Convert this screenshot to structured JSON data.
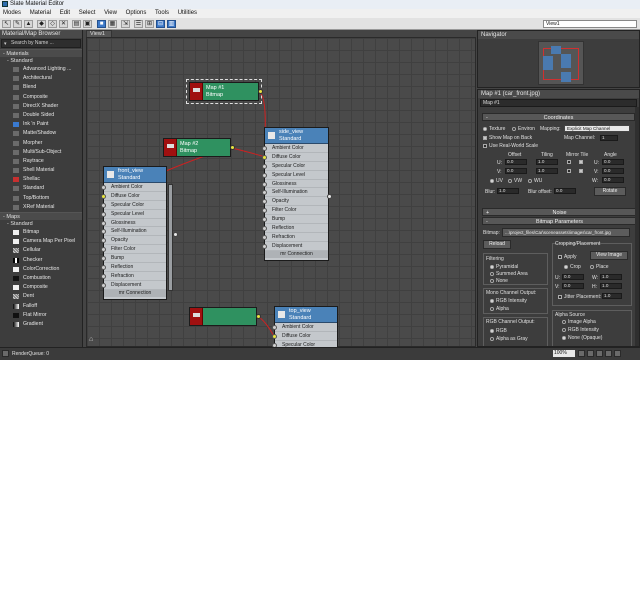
{
  "window": {
    "title": "Slate Material Editor"
  },
  "menu": [
    "Modes",
    "Material",
    "Edit",
    "Select",
    "View",
    "Options",
    "Tools",
    "Utilities"
  ],
  "toolbar": {
    "view_selector": "View1"
  },
  "browser": {
    "title": "Material/Map Browser",
    "search_placeholder": "Search by Name ...",
    "materials_label": "Materials",
    "standard_label": "Standard",
    "materials": [
      {
        "label": "Advanced Lighting ...",
        "swatch": "grey"
      },
      {
        "label": "Architectural",
        "swatch": "grey"
      },
      {
        "label": "Blend",
        "swatch": "grey"
      },
      {
        "label": "Composite",
        "swatch": "grey"
      },
      {
        "label": "DirectX Shader",
        "swatch": "grey"
      },
      {
        "label": "Double Sided",
        "swatch": "grey"
      },
      {
        "label": "Ink 'n Paint",
        "swatch": "blue"
      },
      {
        "label": "Matte/Shadow",
        "swatch": "grey"
      },
      {
        "label": "Morpher",
        "swatch": "grey"
      },
      {
        "label": "Multi/Sub-Object",
        "swatch": "grey"
      },
      {
        "label": "Raytrace",
        "swatch": "grey"
      },
      {
        "label": "Shell Material",
        "swatch": "grey"
      },
      {
        "label": "Shellac",
        "swatch": "red"
      },
      {
        "label": "Standard",
        "swatch": "grey"
      },
      {
        "label": "Top/Bottom",
        "swatch": "grey"
      },
      {
        "label": "XRef Material",
        "swatch": "grey"
      }
    ],
    "maps_label": "Maps",
    "maps_standard_label": "Standard",
    "maps": [
      {
        "label": "Bitmap",
        "swatch": "white"
      },
      {
        "label": "Camera Map Per Pixel",
        "swatch": "white"
      },
      {
        "label": "Cellular",
        "swatch": "noise"
      },
      {
        "label": "Checker",
        "swatch": "check"
      },
      {
        "label": "ColorCorrection",
        "swatch": "white"
      },
      {
        "label": "Combustion",
        "swatch": "black"
      },
      {
        "label": "Composite",
        "swatch": "white"
      },
      {
        "label": "Dent",
        "swatch": "noise"
      },
      {
        "label": "Falloff",
        "swatch": "grad"
      },
      {
        "label": "Flat Mirror",
        "swatch": "black"
      },
      {
        "label": "Gradient",
        "swatch": "grad"
      }
    ]
  },
  "view": {
    "tab_label": "View1"
  },
  "nodes": {
    "map1": {
      "name": "Map #1",
      "type": "Bitmap"
    },
    "map2": {
      "name": "Map #2",
      "type": "Bitmap"
    },
    "map3": {
      "name": "",
      "type": ""
    },
    "front_view": {
      "name": "front_view",
      "type": "Standard"
    },
    "side_view": {
      "name": "side_view",
      "type": "Standard"
    },
    "top_view": {
      "name": "top_view",
      "type": "Standard"
    },
    "slots": [
      "Ambient Color",
      "Diffuse Color",
      "Specular Color",
      "Specular Level",
      "Glossiness",
      "Self-Illumination",
      "Opacity",
      "Filter Color",
      "Bump",
      "Reflection",
      "Refraction",
      "Displacement"
    ],
    "top_slots": [
      "Ambient Color",
      "Diffuse Color",
      "Specular Color"
    ],
    "footer": "mr Connection"
  },
  "navigator": {
    "title": "Navigator"
  },
  "params": {
    "title": "Map #1 (car_front.jpg)",
    "name_value": "Map #1",
    "coordinates": {
      "title": "Coordinates",
      "texture": "Texture",
      "environ": "Environ",
      "mapping_label": "Mapping:",
      "mapping_value": "Explicit Map Channel",
      "show_map": "Show Map on Back",
      "real_world": "Use Real-World Scale",
      "map_channel_label": "Map Channel:",
      "map_channel_value": "1",
      "offset": "Offset",
      "tiling": "Tiling",
      "mirror_tile": "Mirror Tile",
      "angle": "Angle",
      "u": "U:",
      "v": "V:",
      "w": "W:",
      "u_offset": "0.0",
      "v_offset": "0.0",
      "u_tiling": "1.0",
      "v_tiling": "1.0",
      "u_angle": "0.0",
      "v_angle": "0.0",
      "w_angle": "0.0",
      "uv": "UV",
      "vw": "VW",
      "wu": "WU",
      "blur_label": "Blur:",
      "blur_value": "1.0",
      "blur_offset_label": "Blur offset:",
      "blur_offset_value": "0.0",
      "rotate": "Rotate"
    },
    "noise": {
      "title": "Noise"
    },
    "bitmap_params": {
      "title": "Bitmap Parameters",
      "bitmap_label": "Bitmap:",
      "bitmap_path": "...\\project_files\\Car\\sceneassets\\images\\car_front.jpg",
      "reload": "Reload",
      "cropping": "Cropping/Placement",
      "apply": "Apply",
      "view_image": "View Image",
      "crop": "Crop",
      "place": "Place",
      "u": "U:",
      "v": "V:",
      "w": "W:",
      "h": "H:",
      "u_value": "0.0",
      "v_value": "0.0",
      "w_value": "1.0",
      "h_value": "1.0",
      "jitter": "Jitter Placement:",
      "jitter_value": "1.0",
      "filtering": "Filtering",
      "pyramidal": "Pyramidal",
      "summed_area": "Summed Area",
      "none": "None",
      "mono_output": "Mono Channel Output:",
      "rgb_intensity": "RGB Intensity",
      "alpha": "Alpha",
      "rgb_output": "RGB Channel Output:",
      "rgb": "RGB",
      "alpha_as_gray": "Alpha as Gray",
      "alpha_source": "Alpha Source",
      "image_alpha": "Image Alpha",
      "rgb_intensity2": "RGB Intensity",
      "none_opaque": "None (Opaque)"
    }
  },
  "status": {
    "text": "RenderQueue: 0",
    "zoom": "100%"
  }
}
